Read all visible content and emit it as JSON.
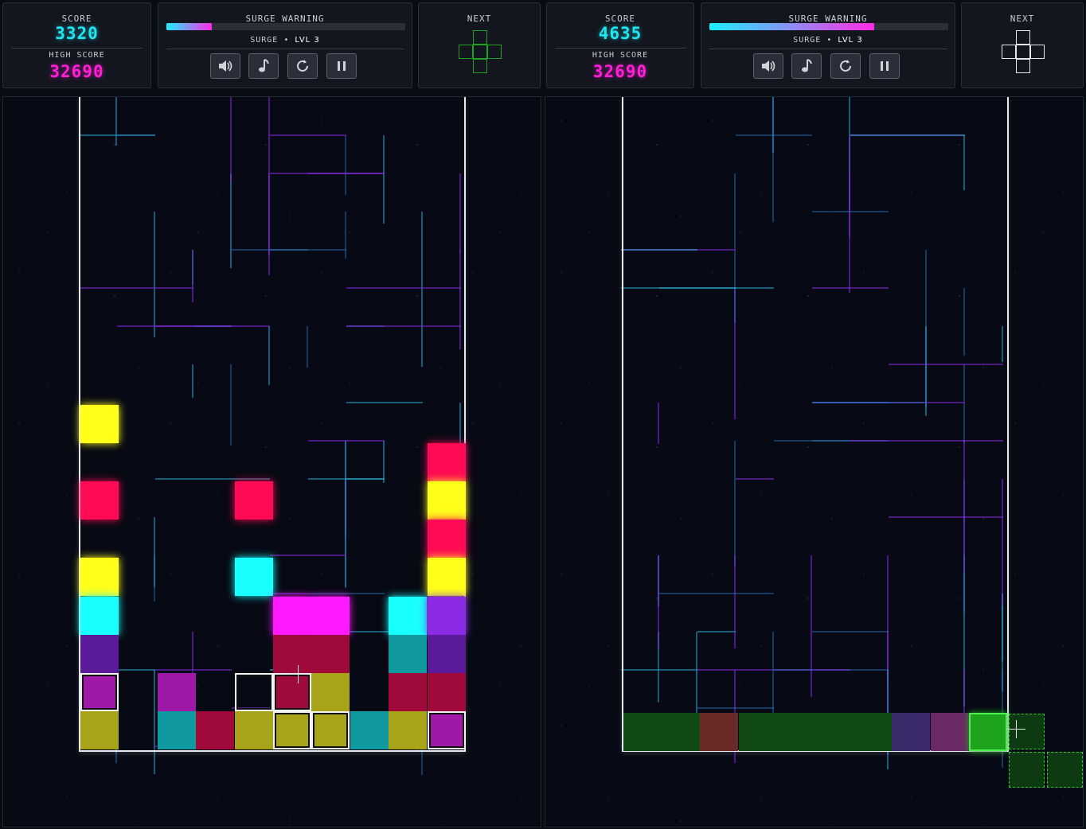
{
  "players": [
    {
      "score_label": "SCORE",
      "score": "3320",
      "high_score_label": "HIGH SCORE",
      "high_score": "32690",
      "surge_title": "SURGE WARNING",
      "surge_fill_fraction": 0.19,
      "surge_label": "SURGE",
      "level_text": "LVL 3",
      "next_label": "NEXT",
      "next_piece_color": "#1ea31e"
    },
    {
      "score_label": "SCORE",
      "score": "4635",
      "high_score_label": "HIGH SCORE",
      "high_score": "32690",
      "surge_title": "SURGE WARNING",
      "surge_fill_fraction": 0.69,
      "surge_label": "SURGE",
      "level_text": "LVL 3",
      "next_label": "NEXT",
      "next_piece_color": "#e6e9f0"
    }
  ],
  "buttons": [
    {
      "name": "sound-button",
      "icon": "speaker-icon"
    },
    {
      "name": "music-button",
      "icon": "music-note-icon"
    },
    {
      "name": "restart-button",
      "icon": "restart-icon"
    },
    {
      "name": "pause-button",
      "icon": "pause-icon"
    }
  ],
  "colors": {
    "yellow": "#ffff1a",
    "red": "#ff0a55",
    "cyan": "#19ffff",
    "magenta": "#ff1aff",
    "purple": "#8b2be6",
    "dim_purple": "#5a1a9a",
    "dim_red": "#a00a3a",
    "olive": "#a8a41a",
    "teal": "#109aa0",
    "dim_magenta": "#a018a8",
    "green": "#1ea31e",
    "dark_green": "#0f4a14"
  },
  "board_left": {
    "columns": 10,
    "rows": 17,
    "cells": [
      {
        "c": 0,
        "r": 8,
        "color": "yellow",
        "glow": true
      },
      {
        "c": 0,
        "r": 10,
        "color": "red",
        "glow": true
      },
      {
        "c": 4,
        "r": 10,
        "color": "red",
        "glow": true
      },
      {
        "c": 9,
        "r": 9,
        "color": "red",
        "glow": true
      },
      {
        "c": 9,
        "r": 10,
        "color": "yellow",
        "glow": true
      },
      {
        "c": 9,
        "r": 11,
        "color": "red",
        "glow": true
      },
      {
        "c": 0,
        "r": 12,
        "color": "yellow",
        "glow": true
      },
      {
        "c": 4,
        "r": 12,
        "color": "cyan",
        "glow": true
      },
      {
        "c": 9,
        "r": 12,
        "color": "yellow",
        "glow": true
      },
      {
        "c": 0,
        "r": 13,
        "color": "cyan",
        "glow": true
      },
      {
        "c": 5,
        "r": 13,
        "color": "magenta",
        "glow": true
      },
      {
        "c": 6,
        "r": 13,
        "color": "magenta",
        "glow": true
      },
      {
        "c": 8,
        "r": 13,
        "color": "cyan",
        "glow": true
      },
      {
        "c": 9,
        "r": 13,
        "color": "purple",
        "glow": true
      },
      {
        "c": 0,
        "r": 14,
        "color": "dim_purple"
      },
      {
        "c": 5,
        "r": 14,
        "color": "dim_red"
      },
      {
        "c": 6,
        "r": 14,
        "color": "dim_red"
      },
      {
        "c": 8,
        "r": 14,
        "color": "teal"
      },
      {
        "c": 9,
        "r": 14,
        "color": "dim_purple"
      },
      {
        "c": 0,
        "r": 15,
        "color": "dim_magenta",
        "outline": true
      },
      {
        "c": 2,
        "r": 15,
        "color": "dim_magenta"
      },
      {
        "c": 4,
        "r": 15,
        "color": "none",
        "outline": true
      },
      {
        "c": 5,
        "r": 15,
        "color": "dim_red",
        "outline": true
      },
      {
        "c": 6,
        "r": 15,
        "color": "olive"
      },
      {
        "c": 8,
        "r": 15,
        "color": "dim_red"
      },
      {
        "c": 9,
        "r": 15,
        "color": "dim_red"
      },
      {
        "c": 0,
        "r": 16,
        "color": "olive"
      },
      {
        "c": 2,
        "r": 16,
        "color": "teal"
      },
      {
        "c": 3,
        "r": 16,
        "color": "dim_red"
      },
      {
        "c": 4,
        "r": 16,
        "color": "olive"
      },
      {
        "c": 5,
        "r": 16,
        "color": "olive",
        "outline": true
      },
      {
        "c": 6,
        "r": 16,
        "color": "olive",
        "outline": true
      },
      {
        "c": 7,
        "r": 16,
        "color": "teal"
      },
      {
        "c": 8,
        "r": 16,
        "color": "olive"
      },
      {
        "c": 9,
        "r": 16,
        "color": "dim_magenta",
        "outline": true
      }
    ]
  },
  "board_right": {
    "columns": 10,
    "rows": 17,
    "bottom_row": [
      "dark_green",
      "dark_green",
      "red_faded",
      "dark_green",
      "dark_green",
      "dark_green",
      "dark_green",
      "purple_faded",
      "magenta_faded",
      "green"
    ],
    "ghost_piece": "dashed-green-outline"
  }
}
